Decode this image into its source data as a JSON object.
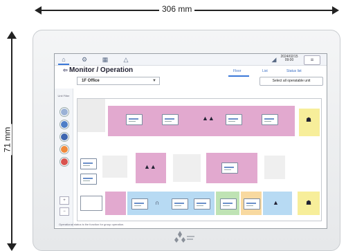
{
  "dimensions": {
    "width_label": "306 mm",
    "height_label": "71 mm"
  },
  "app": {
    "title": "Monitor / Operation",
    "floor_select_value": "1F  Office",
    "date_time": "2024/02/15 09:00",
    "select_all_label": "Select all operatable unit",
    "view_tabs": [
      "Floor",
      "List",
      "Status list"
    ],
    "side_label": "Unit Filter",
    "status_bar_text": "Operational status is the function for group operation."
  },
  "icons": {
    "home": "home-icon",
    "settings": "settings-icon",
    "schedule": "schedule-icon",
    "alarm": "alarm-icon",
    "signal": "signal-icon",
    "menu": "menu-icon",
    "logo": "three-diamond-logo"
  },
  "colors": {
    "pink_zone": "#e2a9cf",
    "blue_zone": "#b7daf3",
    "yellow_zone": "#f7ee9a",
    "green_zone": "#bfe3b4",
    "orange_zone": "#f8d9a0",
    "filter_blue": "#4e7fc7",
    "filter_orange": "#f08a3c",
    "filter_red": "#d9534f"
  }
}
